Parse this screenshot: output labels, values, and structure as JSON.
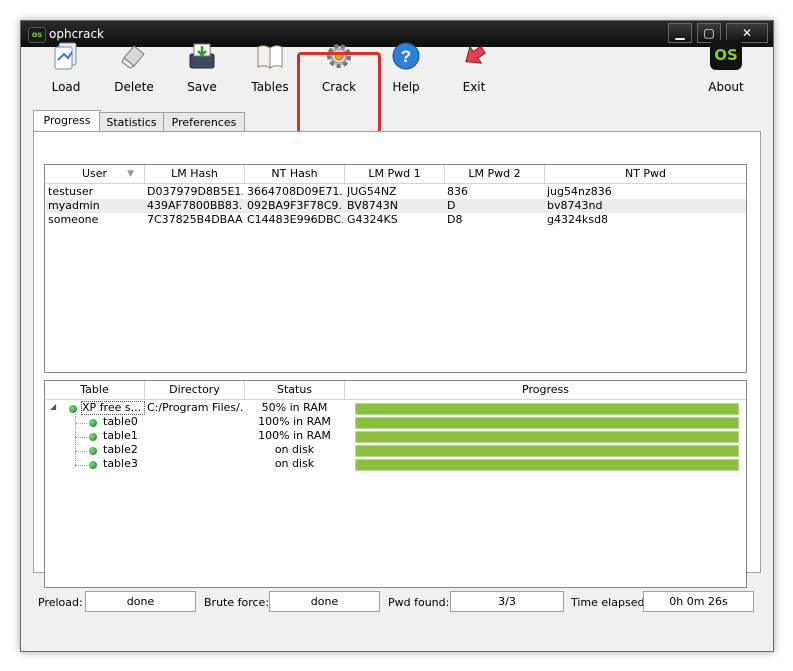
{
  "window": {
    "title": "ophcrack",
    "app_icon_text": "os",
    "minimize": "▁",
    "maximize": "▢",
    "close": "✕"
  },
  "toolbar": {
    "load": "Load",
    "delete": "Delete",
    "save": "Save",
    "tables": "Tables",
    "crack": "Crack",
    "help": "Help",
    "exit": "Exit",
    "about": "About",
    "about_logo": "OS"
  },
  "tabs": [
    "Progress",
    "Statistics",
    "Preferences"
  ],
  "users_table": {
    "headers": [
      "User",
      "LM Hash",
      "NT Hash",
      "LM Pwd 1",
      "LM Pwd 2",
      "NT Pwd"
    ],
    "rows": [
      [
        "testuser",
        "D037979D8B5E1...",
        "3664708D09E71...",
        "JUG54NZ",
        "836",
        "jug54nz836"
      ],
      [
        "myadmin",
        "439AF7800BB83...",
        "092BA9F3F78C9...",
        "BV8743N",
        "D",
        "bv8743nd"
      ],
      [
        "someone",
        "7C37825B4DBAA...",
        "C14483E996DBC...",
        "G4324KS",
        "D8",
        "g4324ksd8"
      ]
    ]
  },
  "tables_table": {
    "headers": [
      "Table",
      "Directory",
      "Status",
      "Progress"
    ],
    "parent": {
      "name": "XP free s...",
      "directory": "C:/Program Files/...",
      "status": "50% in RAM",
      "progress": 1.0
    },
    "children": [
      {
        "name": "table0",
        "status": "100% in RAM",
        "progress": 1.0
      },
      {
        "name": "table1",
        "status": "100% in RAM",
        "progress": 1.0
      },
      {
        "name": "table2",
        "status": "on disk",
        "progress": 1.0
      },
      {
        "name": "table3",
        "status": "on disk",
        "progress": 1.0
      }
    ]
  },
  "status_bar": {
    "preload_label": "Preload:",
    "preload_value": "done",
    "brute_label": "Brute force:",
    "brute_value": "done",
    "pwd_label": "Pwd found:",
    "pwd_value": "3/3",
    "time_label": "Time elapsed:",
    "time_value": "0h 0m 26s"
  },
  "colors": {
    "highlight": "#d9322a",
    "progress_bar": "#8cbf3f",
    "logo_green": "#7fd321"
  }
}
